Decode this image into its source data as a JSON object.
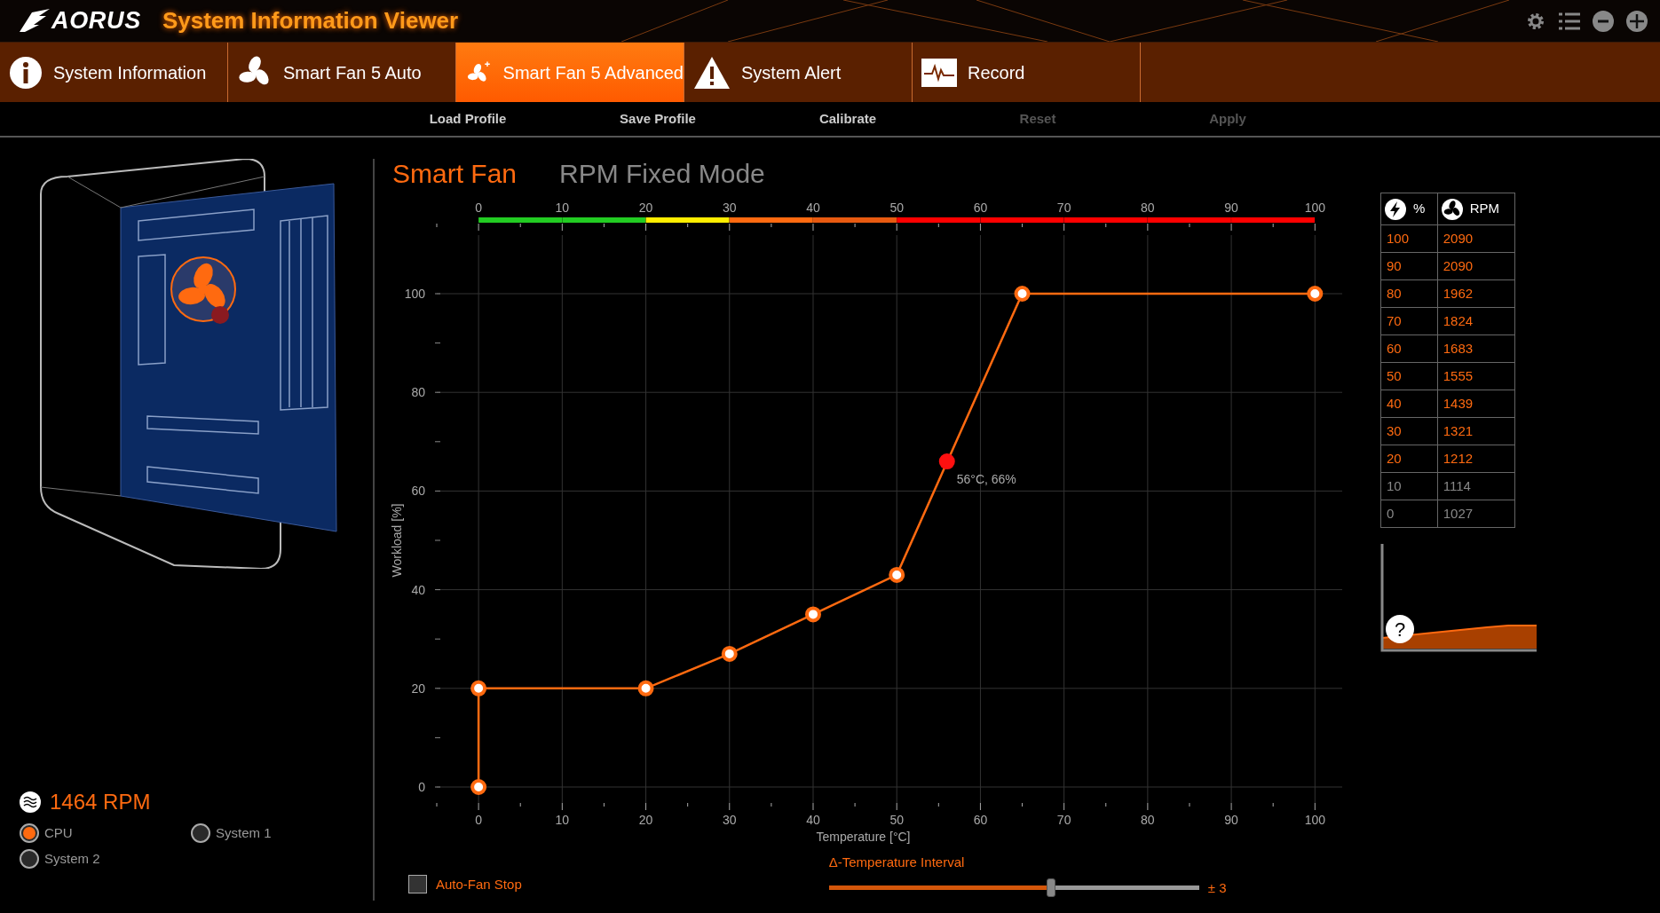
{
  "app": {
    "logo": "AORUS",
    "title": "System Information Viewer"
  },
  "tabs": [
    {
      "label": "System Information",
      "kind": "info",
      "selected": false
    },
    {
      "label": "Smart Fan 5 Auto",
      "kind": "fan",
      "selected": false
    },
    {
      "label": "Smart Fan 5 Advanced",
      "kind": "fan-plus",
      "selected": true
    },
    {
      "label": "System Alert",
      "kind": "alert",
      "selected": false
    },
    {
      "label": "Record",
      "kind": "record",
      "selected": false
    }
  ],
  "toolbar": [
    {
      "label": "Load Profile",
      "disabled": false
    },
    {
      "label": "Save Profile",
      "disabled": false
    },
    {
      "label": "Calibrate",
      "disabled": false
    },
    {
      "label": "Reset",
      "disabled": true
    },
    {
      "label": "Apply",
      "disabled": true
    }
  ],
  "fan_readout": {
    "rpm": "1464 RPM"
  },
  "fan_sources": [
    {
      "label": "CPU",
      "selected": true
    },
    {
      "label": "System 1",
      "selected": false
    },
    {
      "label": "System 2",
      "selected": false
    }
  ],
  "mode_tabs": [
    {
      "label": "Smart Fan",
      "selected": true
    },
    {
      "label": "RPM Fixed Mode",
      "selected": false
    }
  ],
  "temperature_scale": {
    "labels": [
      "0",
      "10",
      "20",
      "30",
      "40",
      "50",
      "60",
      "70",
      "80",
      "90",
      "100"
    ],
    "intervals": [
      {
        "color": "#22cc22"
      },
      {
        "color": "#22cc22"
      },
      {
        "color": "#ffee00"
      },
      {
        "color": "#ff6a10"
      },
      {
        "color": "#e85a10"
      },
      {
        "color": "#ff0000"
      },
      {
        "color": "#ff0000"
      },
      {
        "color": "#ff0000"
      },
      {
        "color": "#ff0000"
      },
      {
        "color": "#ff0000"
      }
    ]
  },
  "chart_data": {
    "type": "line",
    "xlabel": "Temperature [°C]",
    "ylabel": "Workload [%]",
    "x": [
      0,
      0,
      20,
      30,
      40,
      50,
      65,
      100
    ],
    "series": [
      {
        "color": "#ff6a10",
        "marker": "o",
        "values": [
          0,
          20,
          20,
          27,
          35,
          43,
          100,
          100
        ]
      }
    ],
    "xlim": [
      -5,
      104
    ],
    "ylim": [
      0,
      100
    ],
    "grid": true,
    "xticks": [
      0,
      10,
      20,
      30,
      40,
      50,
      60,
      70,
      80,
      90,
      100
    ],
    "yticks": [
      0,
      20,
      40,
      60,
      80,
      100
    ],
    "annotations": [
      {
        "x": 56,
        "y": 66,
        "text": "56°C, 66%"
      }
    ]
  },
  "rpm_table": {
    "columns": [
      "%",
      "RPM"
    ],
    "rows": [
      {
        "cells": [
          "100",
          "2090"
        ],
        "highlighted": true
      },
      {
        "cells": [
          "90",
          "2090"
        ],
        "highlighted": true
      },
      {
        "cells": [
          "80",
          "1962"
        ],
        "highlighted": true
      },
      {
        "cells": [
          "70",
          "1824"
        ],
        "highlighted": true
      },
      {
        "cells": [
          "60",
          "1683"
        ],
        "highlighted": true
      },
      {
        "cells": [
          "50",
          "1555"
        ],
        "highlighted": true
      },
      {
        "cells": [
          "40",
          "1439"
        ],
        "highlighted": true
      },
      {
        "cells": [
          "30",
          "1321"
        ],
        "highlighted": true
      },
      {
        "cells": [
          "20",
          "1212"
        ],
        "highlighted": true
      },
      {
        "cells": [
          "10",
          "1114"
        ],
        "highlighted": false
      },
      {
        "cells": [
          "0",
          "1027"
        ],
        "highlighted": false
      }
    ]
  },
  "help_button": "?",
  "auto_fan_stop": {
    "label": "Auto-Fan Stop",
    "checked": false
  },
  "temperature_interval": {
    "label": "Δ-Temperature Interval",
    "level": 0.6,
    "reading": "± 3"
  }
}
